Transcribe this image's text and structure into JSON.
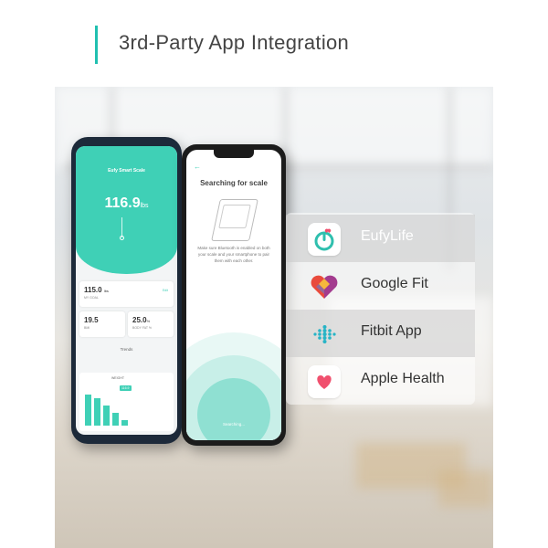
{
  "header": {
    "title": "3rd-Party App Integration"
  },
  "phone_left": {
    "app_name": "Eufy Smart Scale",
    "weight_value": "116.9",
    "weight_unit": "lbs",
    "goal_value": "115.0",
    "goal_unit": "lbs",
    "goal_label": "MY GOAL",
    "goal_action": "Edit",
    "bmi_value": "19.5",
    "bmi_label": "BMI",
    "bodyfat_value": "25.0",
    "bodyfat_unit": "%",
    "bodyfat_label": "BODY FAT %",
    "trends_title": "Trends",
    "chart_label": "WEIGHT",
    "chart_tip": "116.9"
  },
  "phone_right": {
    "back_glyph": "←",
    "screen_title": "Searching for scale",
    "message": "Make sure Bluetooth is enabled on both your scale and your smartphone to pair them with each other.",
    "status": "Searching..."
  },
  "integrations": [
    {
      "label": "EufyLife",
      "icon": "eufylife-icon",
      "accent": "#2fbfae"
    },
    {
      "label": "Google Fit",
      "icon": "google-fit-heart-icon",
      "accent": "#e94b3c"
    },
    {
      "label": "Fitbit App",
      "icon": "fitbit-dots-icon",
      "accent": "#26b4c6"
    },
    {
      "label": "Apple Health",
      "icon": "apple-health-heart-icon",
      "accent": "#f0506e"
    }
  ],
  "colors": {
    "brand_teal": "#3fd0b6",
    "title_bar": "#20c0b0"
  }
}
